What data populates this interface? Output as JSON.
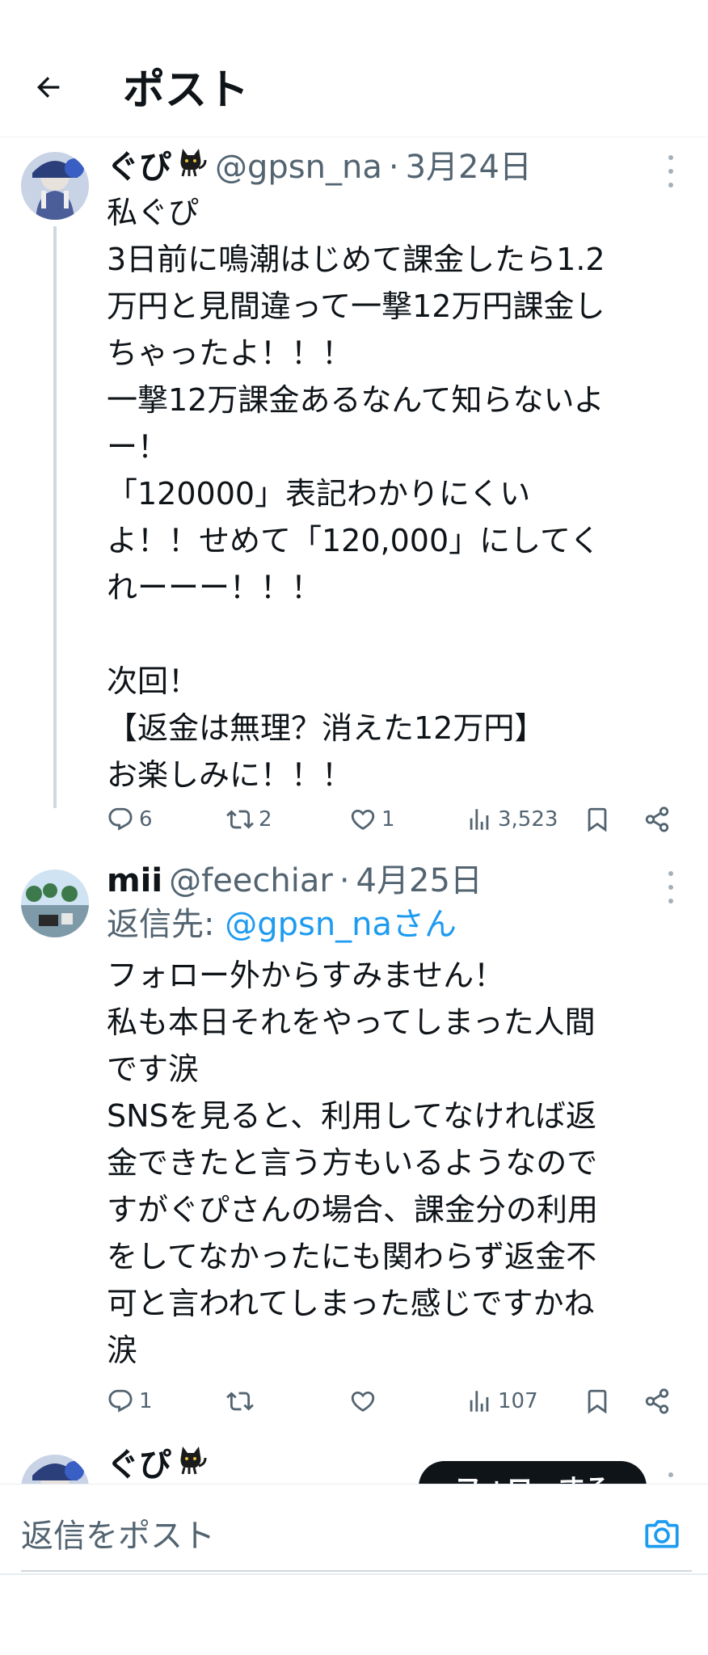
{
  "header": {
    "title": "ポスト"
  },
  "posts": [
    {
      "name": "ぐぴ",
      "handle": "@gpsn_na",
      "separator": "·",
      "date": "3月24日",
      "text": "私ぐぴ\n3日前に鳴潮はじめて課金したら1.2\n万円と見間違って一撃12万円課金し\nちゃったよ！！！\n一撃12万課金あるなんて知らないよ\nー！\n「120000」表記わかりにくい\nよ！！せめて「120,000」にしてく\nれーーー！！！\n\n次回！\n【返金は無理？消えた12万円】\nお楽しみに！！！",
      "stats": {
        "replies": "6",
        "reposts": "2",
        "likes": "1",
        "views": "3,523"
      }
    },
    {
      "name": "mii",
      "handle": "@feechiar",
      "separator": "·",
      "date": "4月25日",
      "reply_prefix": "返信先: ",
      "reply_to": "@gpsn_naさん",
      "text": "フォロー外からすみません！\n私も本日それをやってしまった人間\nです涙\nSNSを見ると、利用してなければ返\n金できたと言う方もいるようなので\nすがぐぴさんの場合、課金分の利用\nをしてなかったにも関わらず返金不\n可と言われてしまった感じですかね\n涙",
      "stats": {
        "replies": "1",
        "reposts": "",
        "likes": "",
        "views": "107"
      }
    },
    {
      "name": "ぐぴ",
      "follow_label": "フォローする"
    }
  ],
  "composer": {
    "placeholder": "返信をポスト"
  },
  "colors": {
    "accent": "#1d9bf0",
    "text": "#0f1419",
    "muted": "#536471"
  },
  "icons": [
    "back-arrow-icon",
    "cat-emoji-icon",
    "more-icon",
    "reply-icon",
    "repost-icon",
    "like-icon",
    "views-icon",
    "bookmark-icon",
    "share-icon",
    "camera-icon"
  ]
}
